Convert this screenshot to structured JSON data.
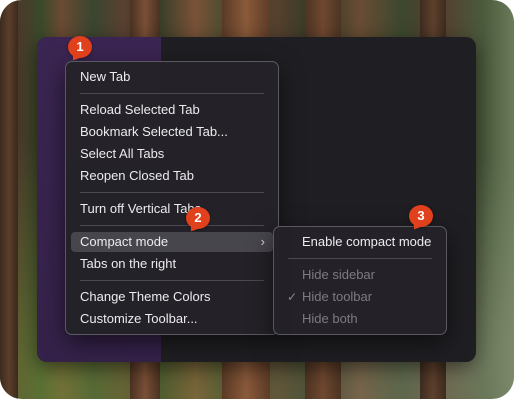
{
  "context_menu": {
    "items": [
      {
        "label": "New Tab"
      },
      {
        "label": "Reload Selected Tab"
      },
      {
        "label": "Bookmark Selected Tab..."
      },
      {
        "label": "Select All Tabs"
      },
      {
        "label": "Reopen Closed Tab"
      },
      {
        "label": "Turn off Vertical Tabs"
      },
      {
        "label": "Compact mode",
        "submenu_indicator": "›",
        "highlighted": true
      },
      {
        "label": "Tabs on the right"
      },
      {
        "label": "Change Theme Colors"
      },
      {
        "label": "Customize Toolbar..."
      }
    ]
  },
  "submenu": {
    "items": [
      {
        "label": "Enable compact mode"
      },
      {
        "label": "Hide sidebar",
        "disabled": true
      },
      {
        "label": "Hide toolbar",
        "checked": true,
        "check_glyph": "✓",
        "disabled": true
      },
      {
        "label": "Hide both",
        "disabled": true
      }
    ]
  },
  "badges": [
    "1",
    "2",
    "3"
  ],
  "colors": {
    "badge": "#e0401c",
    "sidebar": "#3b2552",
    "menu_background": "#242228",
    "highlight": "#48464d"
  }
}
